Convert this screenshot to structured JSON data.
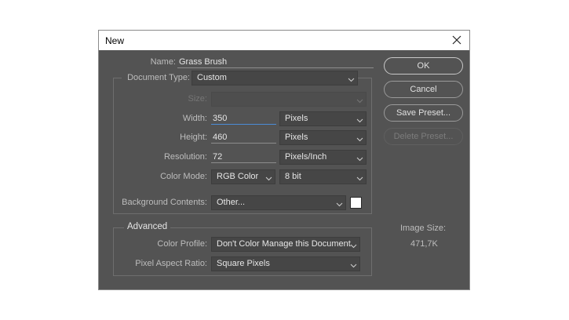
{
  "dialog": {
    "title": "New"
  },
  "fields": {
    "name_label": "Name:",
    "name_value": "Grass Brush",
    "document_type_label": "Document Type:",
    "document_type_value": "Custom",
    "size_label": "Size:",
    "size_value": "",
    "width_label": "Width:",
    "width_value": "350",
    "width_unit": "Pixels",
    "height_label": "Height:",
    "height_value": "460",
    "height_unit": "Pixels",
    "resolution_label": "Resolution:",
    "resolution_value": "72",
    "resolution_unit": "Pixels/Inch",
    "color_mode_label": "Color Mode:",
    "color_mode_value": "RGB Color",
    "bit_depth_value": "8 bit",
    "background_label": "Background Contents:",
    "background_value": "Other...",
    "background_swatch_color": "#ffffff"
  },
  "advanced": {
    "legend": "Advanced",
    "color_profile_label": "Color Profile:",
    "color_profile_value": "Don't Color Manage this Document",
    "pixel_aspect_label": "Pixel Aspect Ratio:",
    "pixel_aspect_value": "Square Pixels"
  },
  "buttons": {
    "ok": "OK",
    "cancel": "Cancel",
    "save_preset": "Save Preset...",
    "delete_preset": "Delete Preset..."
  },
  "image_size": {
    "label": "Image Size:",
    "value": "471,7K"
  },
  "icons": {
    "close": "close-icon",
    "dropdown": "chevron-down-icon"
  }
}
